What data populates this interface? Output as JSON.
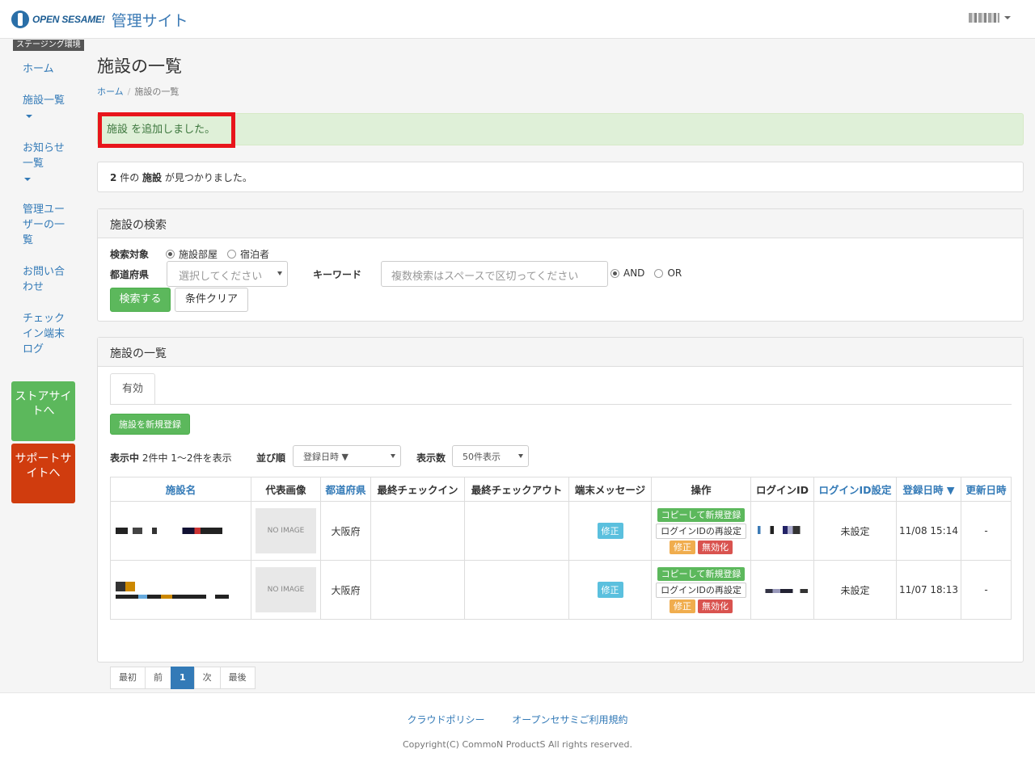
{
  "header": {
    "brand_text": "OPEN SESAME!",
    "site_title": "管理サイト"
  },
  "sidebar": {
    "env_badge": "ステージング環境",
    "items": [
      {
        "label": "ホーム"
      },
      {
        "label": "施設一覧"
      },
      {
        "label": "お知らせ一覧"
      },
      {
        "label": "管理ユーザーの一覧"
      },
      {
        "label": "お問い合わせ"
      },
      {
        "label": "チェックイン端末ログ"
      }
    ],
    "store_button": "ストアサイトへ",
    "support_button": "サポートサイトへ"
  },
  "page": {
    "title": "施設の一覧",
    "breadcrumb_home": "ホーム",
    "breadcrumb_current": "施設の一覧",
    "alert_message": "施設 を追加しました。",
    "found_count": "2",
    "found_mid": "件の",
    "found_entity": "施設",
    "found_suffix": "が見つかりました。"
  },
  "search": {
    "heading": "施設の検索",
    "target_label": "検索対象",
    "target_options": [
      "施設部屋",
      "宿泊者"
    ],
    "target_selected": "施設部屋",
    "pref_label": "都道府県",
    "pref_placeholder": "選択してください",
    "keyword_label": "キーワード",
    "keyword_placeholder": "複数検索はスペースで区切ってください",
    "logic_options": [
      "AND",
      "OR"
    ],
    "logic_selected": "AND",
    "search_button": "検索する",
    "clear_button": "条件クリア"
  },
  "list": {
    "heading": "施設の一覧",
    "tab_active": "有効",
    "new_button": "施設を新規登録",
    "showing_label": "表示中",
    "showing_text": "2件中 1〜2件を表示",
    "sort_label": "並び順",
    "sort_value": "登録日時 ▼",
    "per_page_label": "表示数",
    "per_page_value": "50件表示",
    "columns": [
      "施設名",
      "代表画像",
      "都道府県",
      "最終チェックイン",
      "最終チェックアウト",
      "端末メッセージ",
      "操作",
      "ログインID",
      "ログインID設定",
      "登録日時 ▼",
      "更新日時"
    ],
    "no_image": "NO IMAGE",
    "edit_label": "修正",
    "op_copy": "コピーして新規登録",
    "op_reset_login": "ログインIDの再設定",
    "op_edit": "修正",
    "op_disable": "無効化",
    "rows": [
      {
        "pref": "大阪府",
        "login_setting": "未設定",
        "registered": "11/08 15:14",
        "updated": "-"
      },
      {
        "pref": "大阪府",
        "login_setting": "未設定",
        "registered": "11/07 18:13",
        "updated": "-"
      }
    ],
    "pager": [
      "最初",
      "前",
      "1",
      "次",
      "最後"
    ]
  },
  "footer": {
    "link_cloud": "クラウドポリシー",
    "link_terms": "オープンセサミご利用規約",
    "copyright": "Copyright(C) CommoN ProductS All rights reserved."
  }
}
